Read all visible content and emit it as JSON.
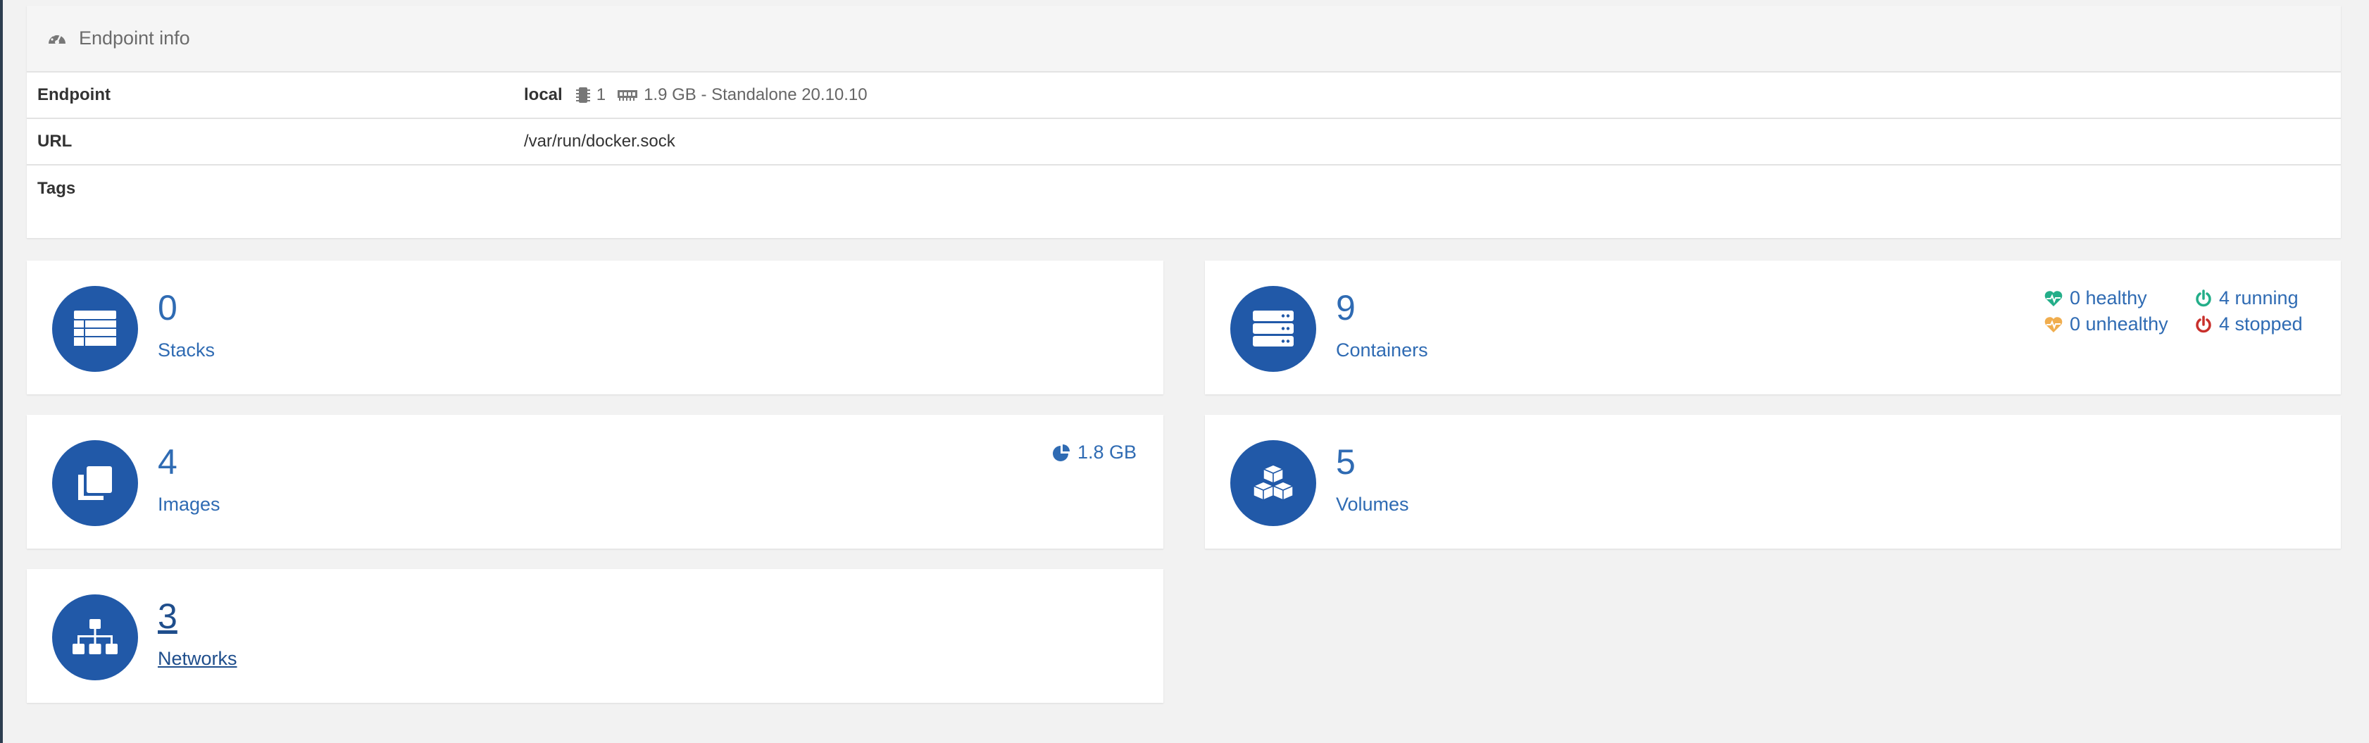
{
  "endpoint_info": {
    "title": "Endpoint info",
    "rows": [
      {
        "key": "Endpoint",
        "name": "local",
        "cpu": "1",
        "memory": "1.9 GB - Standalone 20.10.10"
      },
      {
        "key": "URL",
        "value": "/var/run/docker.sock"
      },
      {
        "key": "Tags",
        "value": ""
      }
    ]
  },
  "tiles": {
    "stacks": {
      "count": "0",
      "label": "Stacks",
      "icon": "table-icon"
    },
    "containers": {
      "count": "9",
      "label": "Containers",
      "icon": "server-icon",
      "healthy": "0 healthy",
      "running": "4 running",
      "unhealthy": "0 unhealthy",
      "stopped": "4 stopped"
    },
    "images": {
      "count": "4",
      "label": "Images",
      "icon": "clone-icon",
      "size": "1.8 GB"
    },
    "volumes": {
      "count": "5",
      "label": "Volumes",
      "icon": "cubes-icon"
    },
    "networks": {
      "count": "3",
      "label": "Networks",
      "icon": "sitemap-icon"
    }
  },
  "colors": {
    "accent": "#2159a8",
    "link": "#2f6bb3",
    "healthy": "#23ae89",
    "unhealthy": "#f0ad4e",
    "stopped": "#c9302c"
  }
}
